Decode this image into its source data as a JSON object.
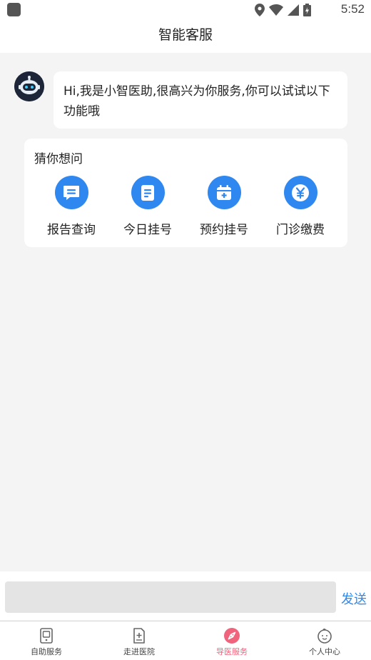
{
  "status_bar": {
    "time": "5:52"
  },
  "header": {
    "title": "智能客服"
  },
  "chat": {
    "bot_message": "Hi,我是小智医助,很高兴为你服务,你可以试试以下功能哦"
  },
  "suggestions": {
    "title": "猜你想问",
    "items": [
      {
        "label": "报告查询",
        "icon": "message-icon"
      },
      {
        "label": "今日挂号",
        "icon": "document-icon"
      },
      {
        "label": "预约挂号",
        "icon": "calendar-plus-icon"
      },
      {
        "label": "门诊缴费",
        "icon": "yuan-icon"
      }
    ]
  },
  "composer": {
    "input_value": "",
    "send_label": "发送"
  },
  "tab_bar": {
    "items": [
      {
        "label": "自助服务",
        "icon": "phone-card-icon",
        "active": false
      },
      {
        "label": "走进医院",
        "icon": "hospital-doc-icon",
        "active": false
      },
      {
        "label": "导医服务",
        "icon": "compass-icon",
        "active": true
      },
      {
        "label": "个人中心",
        "icon": "baby-face-icon",
        "active": false
      }
    ]
  },
  "colors": {
    "accent": "#2f87f0",
    "active_tab": "#f0637d",
    "background": "#f4f4f4"
  }
}
